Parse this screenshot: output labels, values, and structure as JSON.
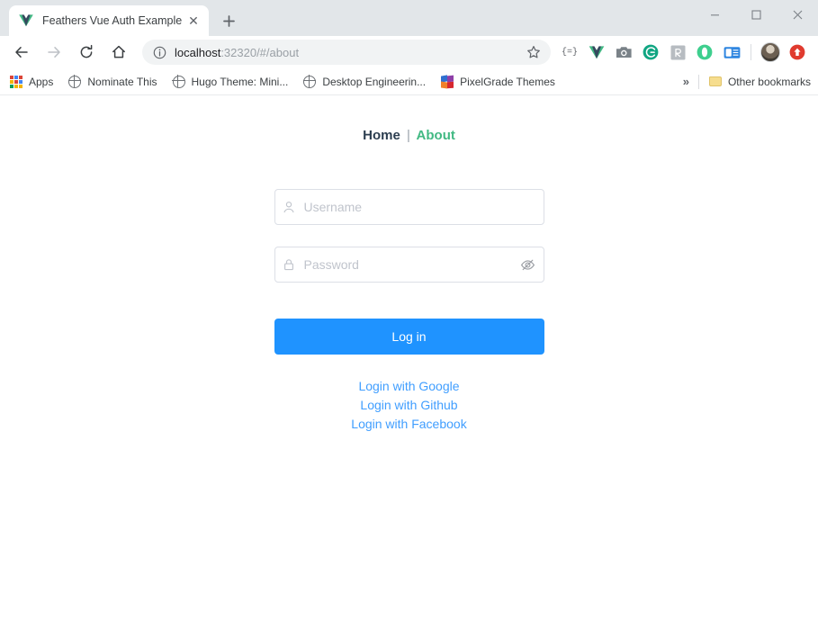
{
  "window": {
    "minimize_label": "—",
    "maximize_label": "□",
    "close_label": "✕"
  },
  "tab": {
    "title": "Feathers Vue Auth Example",
    "favicon": "vue-logo-icon",
    "close_label": "✕",
    "newtab_label": "+"
  },
  "toolbar": {
    "back_label": "←",
    "forward_label": "→",
    "reload_label": "⟳",
    "home_label": "⌂",
    "omnibox": {
      "info_icon": "info-circle-icon",
      "host": "localhost",
      "path": ":32320/#/about",
      "full_url": "localhost:32320/#/about",
      "star_label": "☆"
    },
    "extensions": [
      {
        "name": "json-formatter-extension",
        "label": "{=}",
        "color": "#5f6368"
      },
      {
        "name": "vue-devtools-extension",
        "label": "",
        "color": "#42b883"
      },
      {
        "name": "screenshot-camera-extension",
        "label": "",
        "color": "#7a8288"
      },
      {
        "name": "grammarly-extension",
        "label": "G",
        "color": "#11a683"
      },
      {
        "name": "rainmeter-extension",
        "label": "Ŕ",
        "color": "#9aa0a6"
      },
      {
        "name": "opera-o-extension",
        "label": "O",
        "color": "#3ecf8e"
      },
      {
        "name": "card-reader-extension",
        "label": "",
        "color": "#2f86e0"
      }
    ],
    "profile_avatar": "user-avatar",
    "update_icon": "red-upload-icon"
  },
  "bookmarks": {
    "items": [
      {
        "name": "bookmark-apps",
        "label": "Apps",
        "icon": "apps-grid-icon"
      },
      {
        "name": "bookmark-nominate-this",
        "label": "Nominate This",
        "icon": "globe-icon"
      },
      {
        "name": "bookmark-hugo-theme",
        "label": "Hugo Theme: Mini...",
        "icon": "globe-icon"
      },
      {
        "name": "bookmark-desktop-engineering",
        "label": "Desktop Engineerin...",
        "icon": "globe-icon"
      },
      {
        "name": "bookmark-pixelgrade-themes",
        "label": "PixelGrade Themes",
        "icon": "pixelgrade-icon"
      }
    ],
    "overflow_label": "»",
    "other_bookmarks": {
      "label": "Other bookmarks",
      "icon": "folder-icon"
    }
  },
  "page": {
    "nav": {
      "home_label": "Home",
      "separator": "|",
      "about_label": "About",
      "active": "About",
      "home_color": "#2c3e50",
      "about_color": "#42b983"
    },
    "form": {
      "username": {
        "placeholder": "Username",
        "value": "",
        "icon": "user-icon"
      },
      "password": {
        "placeholder": "Password",
        "value": "",
        "icon": "lock-icon",
        "toggle_icon": "eye-slash-icon",
        "visible": false
      },
      "login_button": {
        "label": "Log in",
        "color": "#1f93ff"
      },
      "social_links": [
        {
          "name": "login-with-google-link",
          "label": "Login with Google"
        },
        {
          "name": "login-with-github-link",
          "label": "Login with Github"
        },
        {
          "name": "login-with-facebook-link",
          "label": "Login with Facebook"
        }
      ],
      "link_color": "#409eff"
    }
  }
}
